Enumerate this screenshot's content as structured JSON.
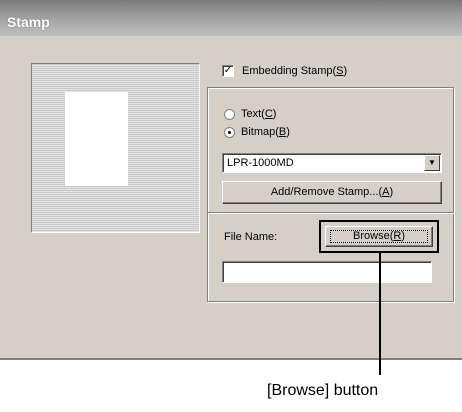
{
  "window": {
    "title": "Stamp"
  },
  "embedding": {
    "label": "Embedding Stamp(",
    "mnemonic": "S",
    "suffix": ")",
    "checked": true,
    "check_glyph": "✓"
  },
  "stamp_type": {
    "text_option": {
      "label": "Text(",
      "mnemonic": "C",
      "suffix": ")",
      "selected": false
    },
    "bitmap_option": {
      "label": "Bitmap(",
      "mnemonic": "B",
      "suffix": ")",
      "selected": true
    }
  },
  "stamp_select": {
    "value": "LPR-1000MD",
    "arrow_glyph": "▼"
  },
  "add_remove_button": {
    "label": "Add/Remove Stamp...(",
    "mnemonic": "A",
    "suffix": ")"
  },
  "file_name": {
    "label": "File Name:",
    "value": ""
  },
  "browse_button": {
    "label": "Browse(",
    "mnemonic": "R",
    "suffix": ")"
  },
  "annotation": {
    "caption": "[Browse] button"
  },
  "colors": {
    "dialog_bg": "#d4d0c8",
    "title_bar": "#8a8a8a",
    "highlight": "#000000"
  }
}
